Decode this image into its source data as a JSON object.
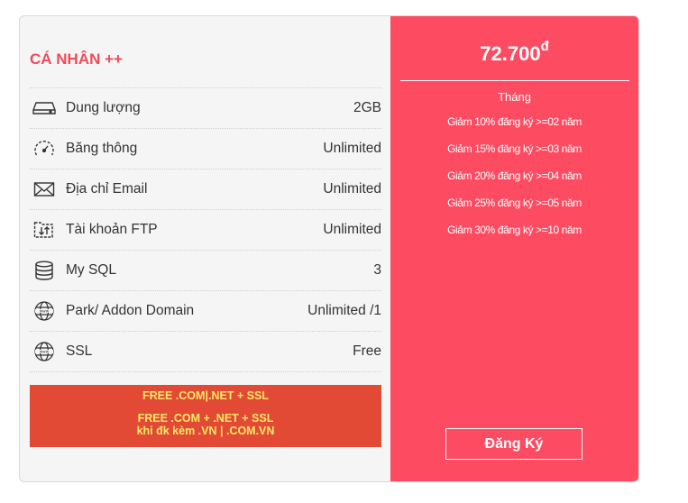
{
  "plan": {
    "title": "CÁ NHÂN ++",
    "specs": [
      {
        "icon": "hard-drive-icon",
        "label": "Dung lượng",
        "value": "2GB"
      },
      {
        "icon": "speedometer-icon",
        "label": "Băng thông",
        "value": "Unlimited"
      },
      {
        "icon": "envelope-icon",
        "label": "Địa chỉ Email",
        "value": "Unlimited"
      },
      {
        "icon": "ftp-transfer-icon",
        "label": "Tài khoản FTP",
        "value": "Unlimited"
      },
      {
        "icon": "database-icon",
        "label": "My SQL",
        "value": "3"
      },
      {
        "icon": "globe-www-icon",
        "label": "Park/ Addon Domain",
        "value": "Unlimited /1"
      },
      {
        "icon": "globe-www-icon",
        "label": "SSL",
        "value": "Free"
      }
    ],
    "promo": {
      "line1": "FREE .COM|.NET + SSL",
      "line2": "FREE .COM + .NET + SSL",
      "line3": "khi đk kèm .VN | .COM.VN"
    }
  },
  "pricing": {
    "price": "72.700",
    "currency": "đ",
    "period": "Tháng",
    "discounts": [
      "Giảm 10% đăng ký >=02 năm",
      "Giảm 15% đăng ký >=03 năm",
      "Giảm 20% đăng ký >=04 năm",
      "Giảm 25% đăng ký >=05 năm",
      "Giảm 30% đăng ký >=10 năm"
    ],
    "register_label": "Đăng Ký"
  },
  "colors": {
    "title": "#f04a5a",
    "price_panel": "#fd4b62",
    "promo_bg": "#e24a35",
    "promo_text": "#ffe866"
  }
}
